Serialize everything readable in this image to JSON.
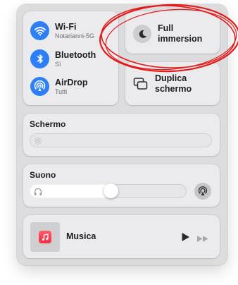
{
  "connectivity": {
    "wifi": {
      "title": "Wi-Fi",
      "subtitle": "Notarianni-5G",
      "icon": "wifi-icon"
    },
    "bluetooth": {
      "title": "Bluetooth",
      "subtitle": "Sì",
      "icon": "bluetooth-icon"
    },
    "airdrop": {
      "title": "AirDrop",
      "subtitle": "Tutti",
      "icon": "airdrop-icon"
    }
  },
  "focus": {
    "label_line1": "Full",
    "label_line2": "immersion",
    "icon": "moon-icon"
  },
  "mirror": {
    "label_line1": "Duplica",
    "label_line2": "schermo",
    "icon": "screen-mirroring-icon"
  },
  "display": {
    "title": "Schermo",
    "brightness_level": 0.0,
    "icon": "sun-icon"
  },
  "sound": {
    "title": "Suono",
    "volume_level": 0.52,
    "icon": "headphones-icon",
    "output_icon": "airplay-audio-icon"
  },
  "music": {
    "title": "Musica",
    "app_icon": "music-note-icon",
    "play_icon": "play-icon",
    "forward_icon": "fast-forward-icon"
  },
  "colors": {
    "accent": "#2d7ff6",
    "annotation": "#e41b1b",
    "panel": "#dcdcde",
    "tile": "#ebebed"
  }
}
